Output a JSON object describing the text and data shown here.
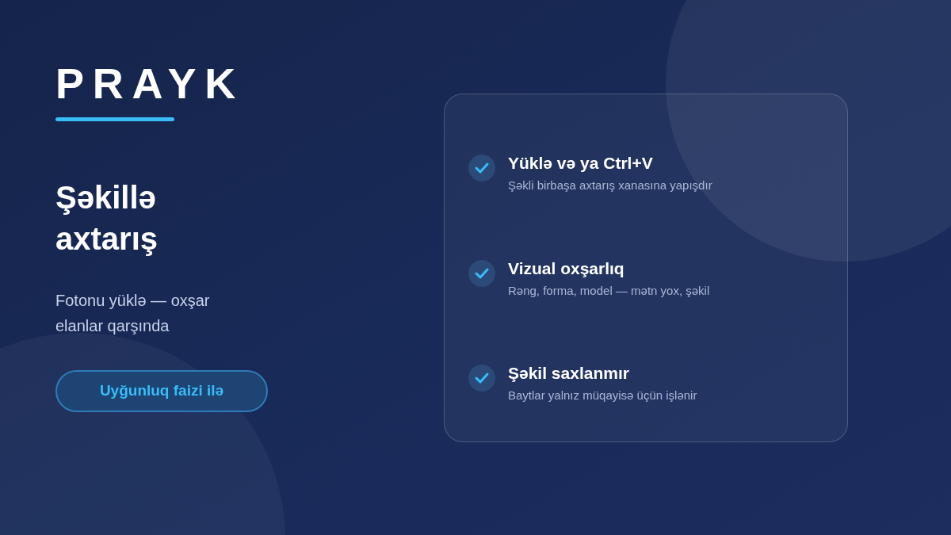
{
  "logo": "PRAYK",
  "heading": "Şəkillə axtarış",
  "subtitle": "Fotonu yüklə — oxşar elanlar qarşında",
  "button": "Uyğunluq faizi ilə",
  "features": [
    {
      "title": "Yüklə və ya Ctrl+V",
      "description": "Şəkli birbaşa axtarış xanasına yapışdır",
      "checked": true
    },
    {
      "title": "Vizual oxşarlıq",
      "description": "Rəng, forma, model — mətn yox, şəkil",
      "checked": true
    },
    {
      "title": "Şəkil saxlanmır",
      "description": "Baytlar yalnız müqayisə üçün işlənir",
      "checked": true
    }
  ]
}
